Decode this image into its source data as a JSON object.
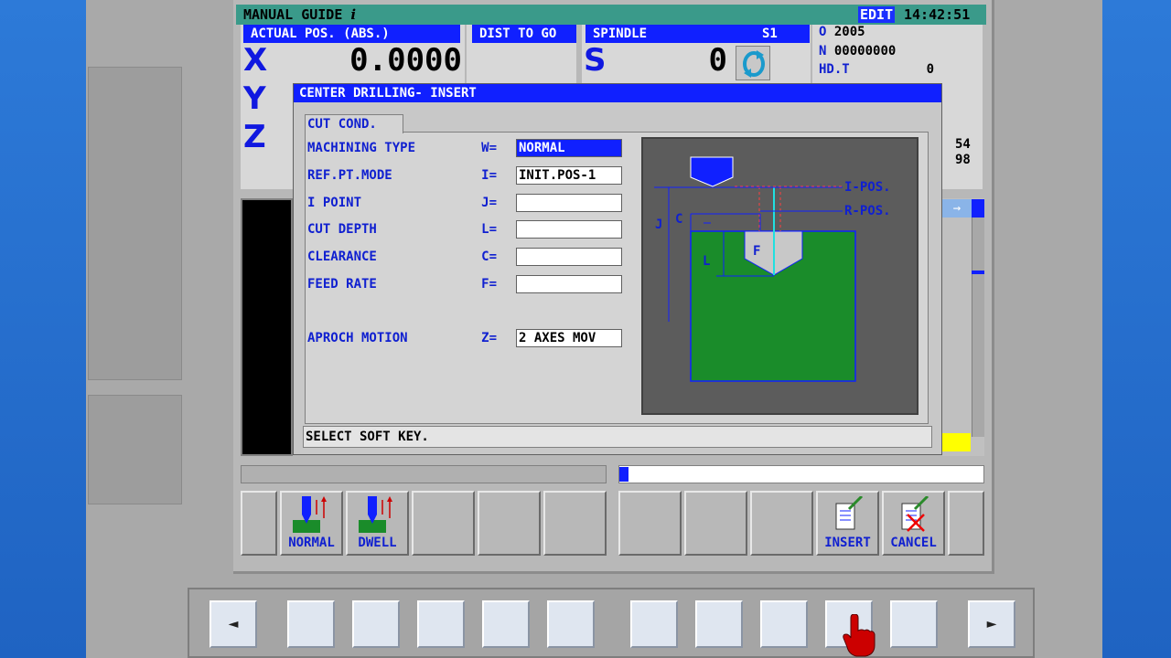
{
  "title": {
    "app": "MANUAL GUIDE",
    "mode": "EDIT",
    "time": "14:42:51"
  },
  "position": {
    "header": "ACTUAL POS. (ABS.)",
    "dist_header": "DIST TO GO",
    "axes": [
      {
        "axis": "X",
        "value": "0.0000"
      },
      {
        "axis": "Y",
        "value": ""
      },
      {
        "axis": "Z",
        "value": ""
      }
    ]
  },
  "spindle": {
    "header": "SPINDLE",
    "id": "S1",
    "axis": "S",
    "value": "0"
  },
  "program": {
    "o_label": "O",
    "o_value": "2005",
    "n_label": "N",
    "n_value": "00000000",
    "hd_label": "HD.T",
    "hd_value": "0",
    "extra1": "54",
    "extra2": "98"
  },
  "dialog": {
    "title": "CENTER DRILLING- INSERT",
    "tab": "CUT COND.",
    "fields": [
      {
        "label": "MACHINING TYPE",
        "letter": "W=",
        "value": "NORMAL"
      },
      {
        "label": "REF.PT.MODE",
        "letter": "I=",
        "value": "INIT.POS-1"
      },
      {
        "label": "I POINT",
        "letter": "J=",
        "value": ""
      },
      {
        "label": "CUT DEPTH",
        "letter": "L=",
        "value": ""
      },
      {
        "label": "CLEARANCE",
        "letter": "C=",
        "value": ""
      },
      {
        "label": "FEED RATE",
        "letter": "F=",
        "value": ""
      },
      {
        "label": "APROCH MOTION",
        "letter": "Z=",
        "value": "2 AXES MOV"
      }
    ],
    "message": "SELECT SOFT KEY.",
    "diagram": {
      "i_pos": "I-POS.",
      "r_pos": "R-POS.",
      "j": "J",
      "c": "C",
      "l": "L",
      "f": "F"
    }
  },
  "softkeys": {
    "normal": "NORMAL",
    "dwell": "DWELL",
    "insert": "INSERT",
    "cancel": "CANCEL"
  },
  "hardkeys": {
    "left": "◄",
    "right": "►"
  },
  "colors": {
    "accent": "#1020ff",
    "title_bar": "#3a9a8a",
    "workpiece": "#1a8c2a",
    "cursor": "#cc0000"
  }
}
